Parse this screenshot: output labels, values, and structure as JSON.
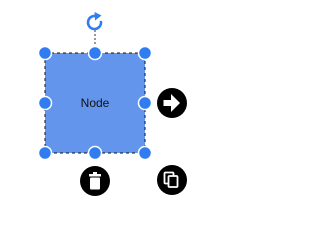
{
  "node": {
    "label": "Node",
    "fill_color": "#6495ed"
  },
  "selection": {
    "handle_color": "#2f7df0",
    "border_style": "dashed"
  },
  "tools": {
    "rotate": {
      "icon": "rotate-icon"
    },
    "connector": {
      "icon": "arrow-right-icon"
    },
    "delete": {
      "icon": "trash-icon"
    },
    "copy": {
      "icon": "copy-icon"
    }
  }
}
